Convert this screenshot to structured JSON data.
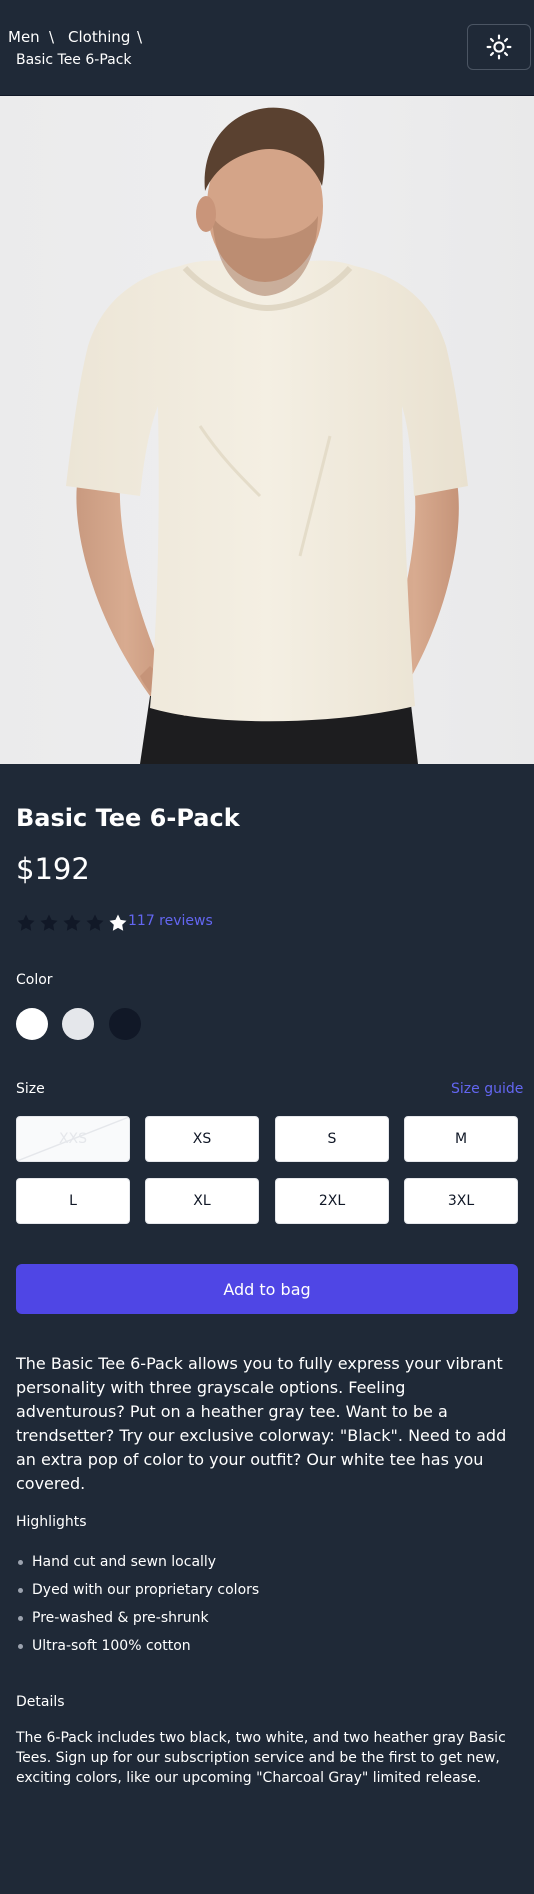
{
  "breadcrumb": {
    "items": [
      "Men",
      "Clothing"
    ],
    "current": "Basic Tee 6-Pack",
    "separator": "\\"
  },
  "theme_toggle": {
    "icon": "sun-icon"
  },
  "hero": {
    "alt": ""
  },
  "product": {
    "title": "Basic Tee 6-Pack",
    "price": "$192",
    "rating": {
      "value": 4,
      "max": 5,
      "reviews_label": "117 reviews"
    }
  },
  "color": {
    "label": "Color",
    "swatches": [
      {
        "name": "white",
        "hex": "#ffffff",
        "selected": false
      },
      {
        "name": "gray",
        "hex": "#e5e7eb",
        "selected": false
      },
      {
        "name": "black",
        "hex": "#111827",
        "selected": false
      }
    ]
  },
  "size": {
    "label": "Size",
    "guide_label": "Size guide",
    "options": [
      {
        "label": "XXS",
        "available": false
      },
      {
        "label": "XS",
        "available": true
      },
      {
        "label": "S",
        "available": true
      },
      {
        "label": "M",
        "available": true
      },
      {
        "label": "L",
        "available": true
      },
      {
        "label": "XL",
        "available": true
      },
      {
        "label": "2XL",
        "available": true
      },
      {
        "label": "3XL",
        "available": true
      }
    ]
  },
  "add_to_bag": "Add to bag",
  "description": "The Basic Tee 6-Pack allows you to fully express your vibrant personality with three grayscale options. Feeling adventurous? Put on a heather gray tee. Want to be a trendsetter? Try our exclusive colorway: \"Black\". Need to add an extra pop of color to your outfit? Our white tee has you covered.",
  "highlights": {
    "title": "Highlights",
    "items": [
      "Hand cut and sewn locally",
      "Dyed with our proprietary colors",
      "Pre-washed & pre-shrunk",
      "Ultra-soft 100% cotton"
    ]
  },
  "details": {
    "title": "Details",
    "text": "The 6-Pack includes two black, two white, and two heather gray Basic Tees. Sign up for our subscription service and be the first to get new, exciting colors, like our upcoming \"Charcoal Gray\" limited release."
  },
  "colors": {
    "background": "#1f2937",
    "accent": "#4f46e5",
    "link": "#6366f1",
    "star_filled": "#111827",
    "star_empty": "#ffffff"
  }
}
